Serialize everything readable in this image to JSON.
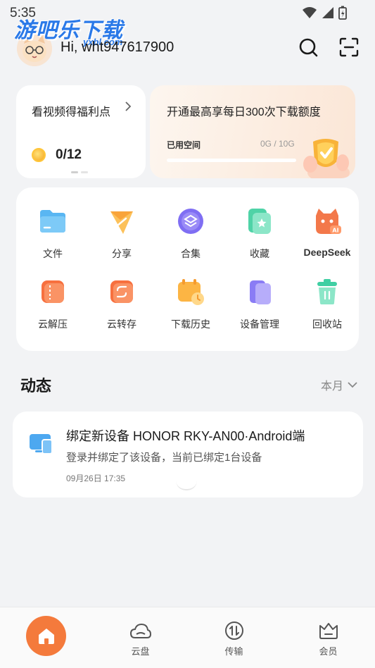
{
  "status_bar": {
    "time": "5:35"
  },
  "watermark": {
    "main": "游吧乐下载",
    "sub": "yxbl.com"
  },
  "header": {
    "greeting": "Hi, wht947617900"
  },
  "welfare_card": {
    "title": "看视频得福利点",
    "progress": "0/12"
  },
  "vip_card": {
    "promo": "开通最高享每日300次下载额度",
    "space_label": "已用空间",
    "space_value": "0G / 10G",
    "space_used_fraction": 0
  },
  "grid": {
    "items": [
      {
        "label": "文件"
      },
      {
        "label": "分享"
      },
      {
        "label": "合集"
      },
      {
        "label": "收藏"
      },
      {
        "label": "DeepSeek"
      },
      {
        "label": "云解压"
      },
      {
        "label": "云转存"
      },
      {
        "label": "下载历史"
      },
      {
        "label": "设备管理"
      },
      {
        "label": "回收站"
      }
    ]
  },
  "activity": {
    "title": "动态",
    "filter": "本月",
    "items": [
      {
        "heading": "绑定新设备  HONOR  RKY-AN00·Android端",
        "description": "登录并绑定了该设备，当前已绑定1台设备",
        "time": "09月26日 17:35"
      }
    ]
  },
  "bottom_nav": {
    "items": [
      {
        "label": ""
      },
      {
        "label": "云盘"
      },
      {
        "label": "传输"
      },
      {
        "label": "会员"
      }
    ]
  },
  "colors": {
    "accent": "#f47a3c",
    "watermark": "#2a79e8"
  }
}
